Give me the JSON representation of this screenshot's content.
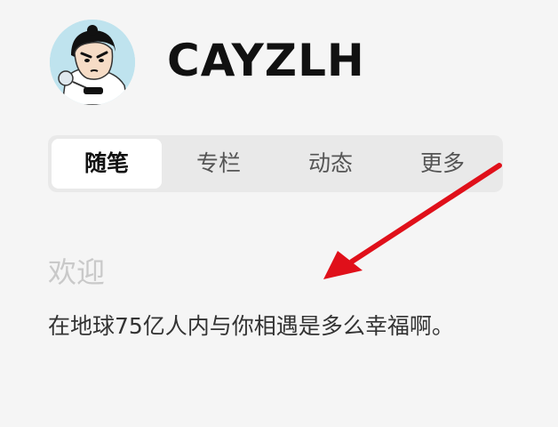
{
  "profile": {
    "name": "CAYZLH",
    "avatar_icon": "cartoon-boy-avatar-icon"
  },
  "tabs": [
    {
      "label": "随笔",
      "active": true
    },
    {
      "label": "专栏",
      "active": false
    },
    {
      "label": "动态",
      "active": false
    },
    {
      "label": "更多",
      "active": false
    }
  ],
  "content": {
    "title": "欢迎",
    "message": "在地球75亿人内与你相遇是多么幸福啊。"
  },
  "annotation": {
    "icon": "red-arrow-icon",
    "color": "#e0101a"
  },
  "colors": {
    "background": "#f5f5f5",
    "tab_bar": "#e9e9e9",
    "tab_active": "#ffffff",
    "welcome_title": "#c9c9c9"
  }
}
